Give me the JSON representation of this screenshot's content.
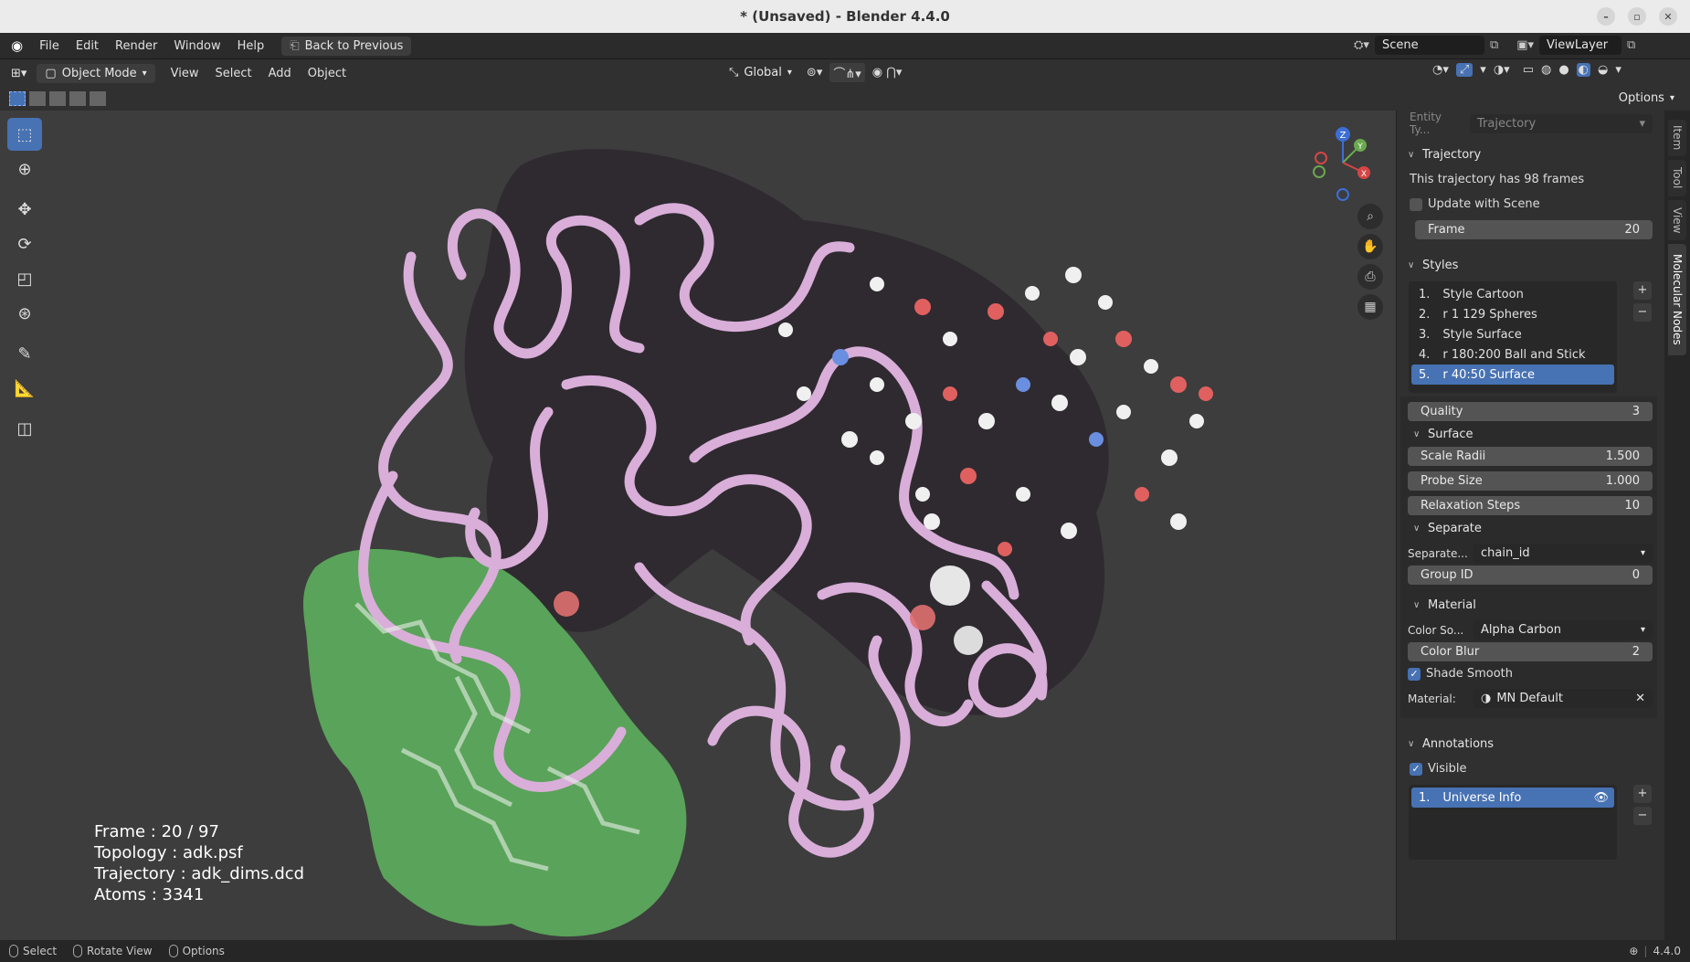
{
  "window": {
    "title": "* (Unsaved) - Blender 4.4.0"
  },
  "menubar": {
    "items": [
      "File",
      "Edit",
      "Render",
      "Window",
      "Help"
    ],
    "back_button": "Back to Previous",
    "scene": "Scene",
    "view_layer": "ViewLayer"
  },
  "header": {
    "mode": "Object Mode",
    "menus": [
      "View",
      "Select",
      "Add",
      "Object"
    ],
    "orientation": "Global"
  },
  "header3": {
    "options": "Options"
  },
  "viewport": {
    "overlay_lines": [
      "Frame : 20 / 97",
      "Topology : adk.psf",
      "Trajectory : adk_dims.dcd",
      "Atoms : 3341"
    ],
    "gizmo": {
      "z": "Z",
      "y": "Y",
      "x": "X"
    }
  },
  "npanel": {
    "entity_label": "Entity Ty...",
    "entity_value": "Trajectory",
    "trajectory": {
      "title": "Trajectory",
      "info": "This trajectory has 98 frames",
      "update_label": "Update with Scene",
      "frame_label": "Frame",
      "frame_value": "20"
    },
    "styles": {
      "title": "Styles",
      "items": [
        {
          "num": "1.",
          "label": "Style Cartoon"
        },
        {
          "num": "2.",
          "label": "r 1 129 Spheres"
        },
        {
          "num": "3.",
          "label": "Style Surface"
        },
        {
          "num": "4.",
          "label": "r 180:200  Ball and Stick"
        },
        {
          "num": "5.",
          "label": "r 40:50 Surface"
        }
      ]
    },
    "quality": {
      "label": "Quality",
      "value": "3"
    },
    "surface": {
      "title": "Surface",
      "scale_radii_label": "Scale Radii",
      "scale_radii": "1.500",
      "probe_label": "Probe Size",
      "probe": "1.000",
      "relax_label": "Relaxation Steps",
      "relax": "10"
    },
    "separate": {
      "title": "Separate",
      "sep_label": "Separate...",
      "sep_value": "chain_id",
      "group_label": "Group ID",
      "group_value": "0"
    },
    "material": {
      "title": "Material",
      "color_src_label": "Color So...",
      "color_src": "Alpha Carbon",
      "blur_label": "Color Blur",
      "blur": "2",
      "smooth_label": "Shade Smooth",
      "mat_label": "Material:",
      "mat_value": "MN Default"
    },
    "annotations": {
      "title": "Annotations",
      "visible_label": "Visible",
      "items": [
        {
          "num": "1.",
          "label": "Universe Info"
        }
      ]
    }
  },
  "tabs": [
    "Item",
    "Tool",
    "View",
    "Molecular Nodes"
  ],
  "status": {
    "select": "Select",
    "rotate": "Rotate View",
    "options": "Options",
    "version": "4.4.0"
  }
}
